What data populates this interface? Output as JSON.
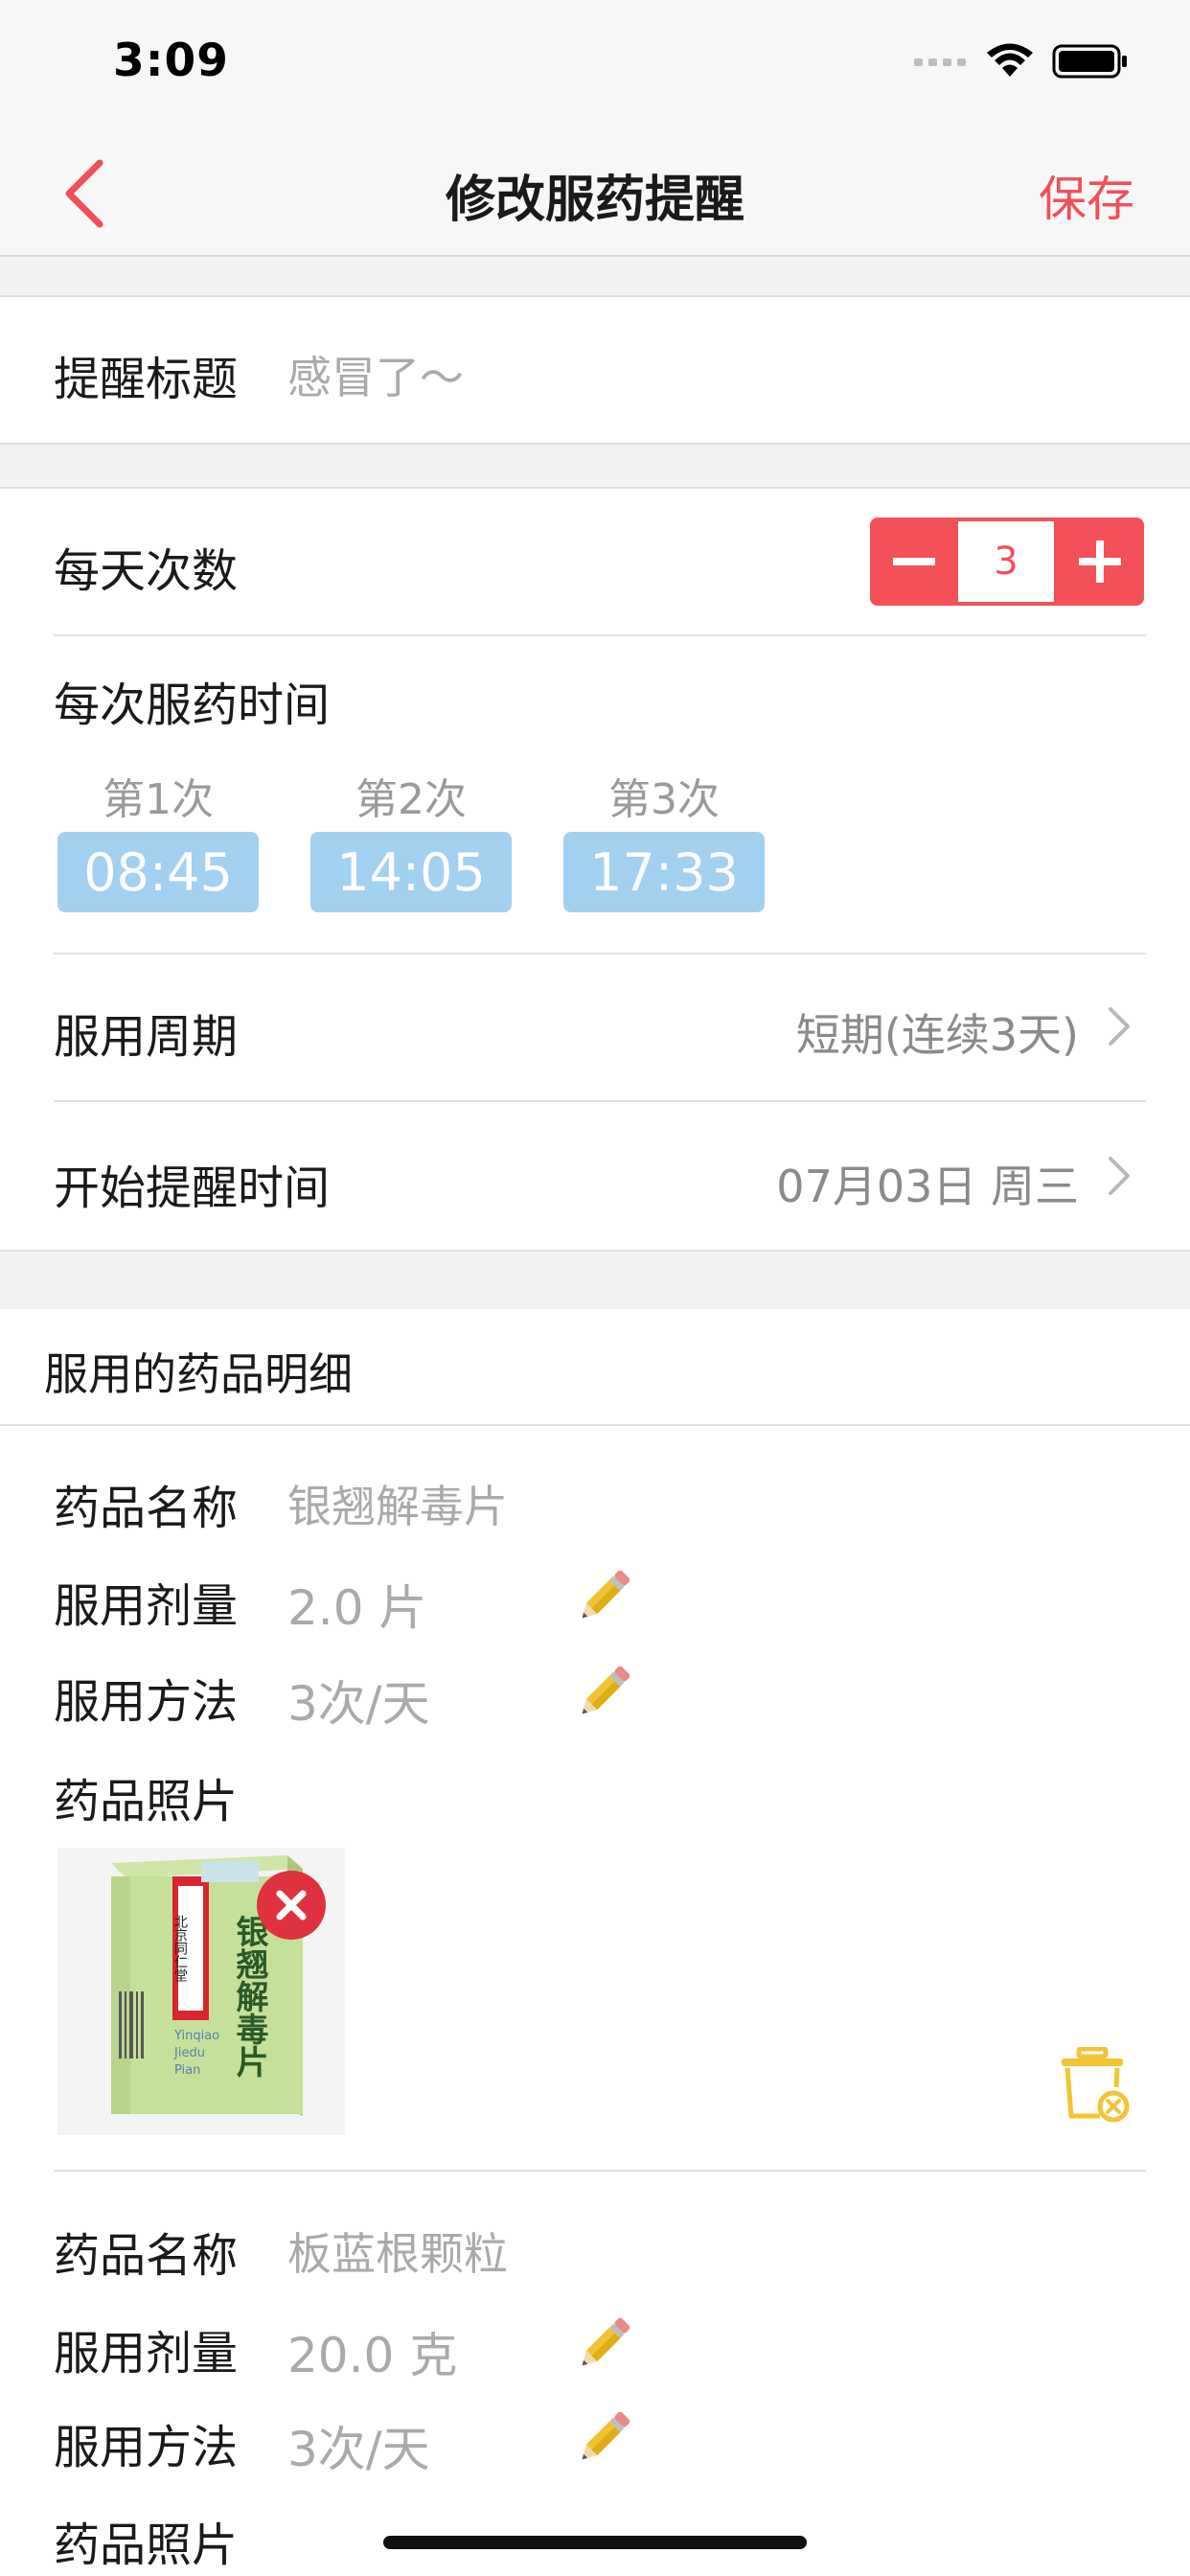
{
  "status_bar": {
    "time": "3:09"
  },
  "nav": {
    "back_icon": "chevron-left-icon",
    "title": "修改服药提醒",
    "save_label": "保存"
  },
  "reminder_title": {
    "label": "提醒标题",
    "placeholder": "感冒了～"
  },
  "daily_count": {
    "label": "每天次数",
    "value": "3",
    "minus": "−",
    "plus": "+"
  },
  "dose_times": {
    "label": "每次服药时间",
    "slots": [
      {
        "label": "第1次",
        "time": "08:45"
      },
      {
        "label": "第2次",
        "time": "14:05"
      },
      {
        "label": "第3次",
        "time": "17:33"
      }
    ]
  },
  "cycle": {
    "label": "服用周期",
    "value": "短期(连续3天)"
  },
  "start_time": {
    "label": "开始提醒时间",
    "value": "07月03日 周三"
  },
  "details": {
    "header": "服用的药品明细",
    "medicines": [
      {
        "name_label": "药品名称",
        "name_value": "银翘解毒片",
        "dose_label": "服用剂量",
        "dose_value": "2.0 片",
        "method_label": "服用方法",
        "method_value": "3次/天",
        "photo_label": "药品照片",
        "photo": {
          "brand": "北京同仁堂",
          "title": "银翘解毒片",
          "pinyin1": "Yinqiao",
          "pinyin2": "Jiedu",
          "pinyin3": "Pian"
        }
      },
      {
        "name_label": "药品名称",
        "name_value": "板蓝根颗粒",
        "dose_label": "服用剂量",
        "dose_value": "20.0 克",
        "method_label": "服用方法",
        "method_value": "3次/天",
        "photo_label": "药品照片"
      }
    ]
  },
  "colors": {
    "accent_red": "#f0505a",
    "chip_blue": "#a3d1f2",
    "trash_yellow": "#f3c433",
    "pencil": "#f1c232"
  }
}
